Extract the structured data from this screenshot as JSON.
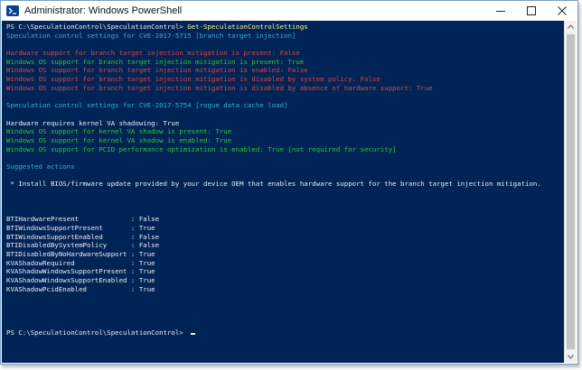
{
  "window": {
    "title": "Administrator: Windows PowerShell",
    "console_bg": "#012456"
  },
  "console": {
    "lines": [
      {
        "color": "white",
        "prompt": "PS C:\\SpeculationControl\\SpeculationControl> ",
        "command": "Get-SpeculationControlSettings"
      },
      {
        "color": "cyan",
        "text": "Speculation control settings for CVE-2017-5715 [branch target injection]"
      },
      {
        "color": "white",
        "text": ""
      },
      {
        "color": "red",
        "text": "Hardware support for branch target injection mitigation is present: False"
      },
      {
        "color": "green",
        "text": "Windows OS support for branch target injection mitigation is present: True"
      },
      {
        "color": "red",
        "text": "Windows OS support for branch target injection mitigation is enabled: False"
      },
      {
        "color": "red",
        "text": "Windows OS support for branch target injection mitigation is disabled by system policy: False"
      },
      {
        "color": "red",
        "text": "Windows OS support for branch target injection mitigation is disabled by absence of hardware support: True"
      },
      {
        "color": "white",
        "text": ""
      },
      {
        "color": "cyan",
        "text": "Speculation control settings for CVE-2017-5754 [rogue data cache load]"
      },
      {
        "color": "white",
        "text": ""
      },
      {
        "color": "white",
        "text": "Hardware requires kernel VA shadowing: True"
      },
      {
        "color": "green",
        "text": "Windows OS support for kernel VA shadow is present: True"
      },
      {
        "color": "green",
        "text": "Windows OS support for kernel VA shadow is enabled: True"
      },
      {
        "color": "green",
        "text": "Windows OS support for PCID performance optimization is enabled: True [not required for security]"
      },
      {
        "color": "white",
        "text": ""
      },
      {
        "color": "cyan",
        "text": "Suggested actions"
      },
      {
        "color": "white",
        "text": ""
      },
      {
        "color": "white",
        "text": " * Install BIOS/firmware update provided by your device OEM that enables hardware support for the branch target injection mitigation."
      },
      {
        "color": "white",
        "text": ""
      },
      {
        "color": "white",
        "text": ""
      },
      {
        "color": "white",
        "text": ""
      },
      {
        "color": "white",
        "text": "BTIHardwarePresent             : False"
      },
      {
        "color": "white",
        "text": "BTIWindowsSupportPresent       : True"
      },
      {
        "color": "white",
        "text": "BTIWindowsSupportEnabled       : False"
      },
      {
        "color": "white",
        "text": "BTIDisabledBySystemPolicy      : False"
      },
      {
        "color": "white",
        "text": "BTIDisabledByNoHardwareSupport : True"
      },
      {
        "color": "white",
        "text": "KVAShadowRequired              : True"
      },
      {
        "color": "white",
        "text": "KVAShadowWindowsSupportPresent : True"
      },
      {
        "color": "white",
        "text": "KVAShadowWindowsSupportEnabled : True"
      },
      {
        "color": "white",
        "text": "KVAShadowPcidEnabled           : True"
      },
      {
        "color": "white",
        "text": ""
      },
      {
        "color": "white",
        "text": ""
      },
      {
        "color": "white",
        "text": ""
      },
      {
        "color": "white",
        "text": ""
      },
      {
        "color": "white",
        "prompt": "PS C:\\SpeculationControl\\SpeculationControl> ",
        "command": "",
        "cursor": true
      }
    ]
  },
  "icons": {
    "app": "powershell-icon",
    "minimize": "minimize-icon",
    "maximize": "maximize-icon",
    "close": "close-icon",
    "scroll_up": "chevron-up-icon",
    "scroll_down": "chevron-down-icon"
  }
}
